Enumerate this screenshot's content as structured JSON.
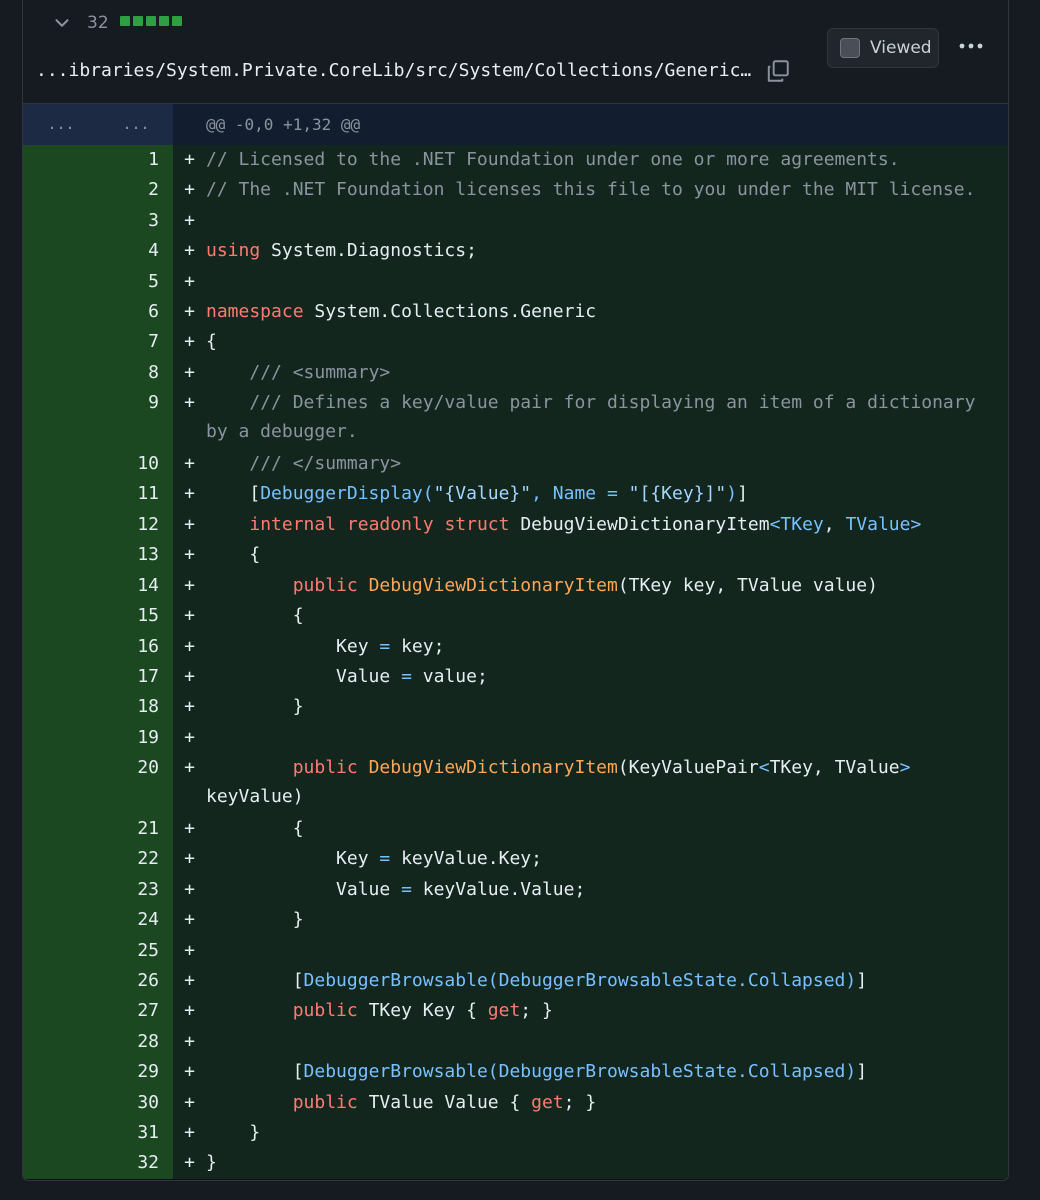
{
  "header": {
    "lines_count": "32",
    "path": "...ibraries/System.Private.CoreLib/src/System/Collections/Generic…",
    "viewed_label": "Viewed"
  },
  "hunk": {
    "old_gutter": "...",
    "new_gutter": "...",
    "header": "@@ -0,0 +1,32 @@"
  },
  "diff": {
    "marker": "+",
    "lines": [
      {
        "n": "1",
        "tokens": [
          [
            "c",
            "// Licensed to the .NET Foundation under one or more agreements."
          ]
        ]
      },
      {
        "n": "2",
        "tokens": [
          [
            "c",
            "// The .NET Foundation licenses this file to you under the MIT license."
          ]
        ]
      },
      {
        "n": "3",
        "tokens": []
      },
      {
        "n": "4",
        "tokens": [
          [
            "k",
            "using"
          ],
          [
            "p",
            " System.Diagnostics;"
          ]
        ]
      },
      {
        "n": "5",
        "tokens": []
      },
      {
        "n": "6",
        "tokens": [
          [
            "k",
            "namespace"
          ],
          [
            "p",
            " System.Collections.Generic"
          ]
        ]
      },
      {
        "n": "7",
        "tokens": [
          [
            "p",
            "{"
          ]
        ]
      },
      {
        "n": "8",
        "tokens": [
          [
            "p",
            "    "
          ],
          [
            "c",
            "/// <summary>"
          ]
        ]
      },
      {
        "n": "9",
        "tokens": [
          [
            "p",
            "    "
          ],
          [
            "c",
            "/// Defines a key/value pair for displaying an item of a dictionary"
          ]
        ],
        "cont": [
          [
            "c",
            "by a debugger."
          ]
        ]
      },
      {
        "n": "10",
        "tokens": [
          [
            "p",
            "    "
          ],
          [
            "c",
            "/// </summary>"
          ]
        ]
      },
      {
        "n": "11",
        "tokens": [
          [
            "p",
            "    ["
          ],
          [
            "a",
            "DebuggerDisplay("
          ],
          [
            "s",
            "\"{Value}\""
          ],
          [
            "a",
            ", Name = "
          ],
          [
            "s",
            "\"[{Key}]\""
          ],
          [
            "a",
            ")"
          ],
          [
            "p",
            "]"
          ]
        ]
      },
      {
        "n": "12",
        "tokens": [
          [
            "p",
            "    "
          ],
          [
            "k",
            "internal"
          ],
          [
            "p",
            " "
          ],
          [
            "k",
            "readonly"
          ],
          [
            "p",
            " "
          ],
          [
            "k",
            "struct"
          ],
          [
            "p",
            " DebugViewDictionaryItem"
          ],
          [
            "a",
            "<TKey"
          ],
          [
            "p",
            ", "
          ],
          [
            "a",
            "TValue>"
          ]
        ]
      },
      {
        "n": "13",
        "tokens": [
          [
            "p",
            "    {"
          ]
        ]
      },
      {
        "n": "14",
        "tokens": [
          [
            "p",
            "        "
          ],
          [
            "k",
            "public"
          ],
          [
            "p",
            " "
          ],
          [
            "f",
            "DebugViewDictionaryItem"
          ],
          [
            "p",
            "(TKey key, TValue value)"
          ]
        ]
      },
      {
        "n": "15",
        "tokens": [
          [
            "p",
            "        {"
          ]
        ]
      },
      {
        "n": "16",
        "tokens": [
          [
            "p",
            "            Key "
          ],
          [
            "a",
            "="
          ],
          [
            "p",
            " key;"
          ]
        ]
      },
      {
        "n": "17",
        "tokens": [
          [
            "p",
            "            Value "
          ],
          [
            "a",
            "="
          ],
          [
            "p",
            " value;"
          ]
        ]
      },
      {
        "n": "18",
        "tokens": [
          [
            "p",
            "        }"
          ]
        ]
      },
      {
        "n": "19",
        "tokens": []
      },
      {
        "n": "20",
        "tokens": [
          [
            "p",
            "        "
          ],
          [
            "k",
            "public"
          ],
          [
            "p",
            " "
          ],
          [
            "f",
            "DebugViewDictionaryItem"
          ],
          [
            "p",
            "(KeyValuePair"
          ],
          [
            "a",
            "<"
          ],
          [
            "p",
            "TKey, TValue"
          ],
          [
            "a",
            ">"
          ]
        ],
        "cont": [
          [
            "p",
            "keyValue)"
          ]
        ]
      },
      {
        "n": "21",
        "tokens": [
          [
            "p",
            "        {"
          ]
        ]
      },
      {
        "n": "22",
        "tokens": [
          [
            "p",
            "            Key "
          ],
          [
            "a",
            "="
          ],
          [
            "p",
            " keyValue.Key;"
          ]
        ]
      },
      {
        "n": "23",
        "tokens": [
          [
            "p",
            "            Value "
          ],
          [
            "a",
            "="
          ],
          [
            "p",
            " keyValue.Value;"
          ]
        ]
      },
      {
        "n": "24",
        "tokens": [
          [
            "p",
            "        }"
          ]
        ]
      },
      {
        "n": "25",
        "tokens": []
      },
      {
        "n": "26",
        "tokens": [
          [
            "p",
            "        ["
          ],
          [
            "a",
            "DebuggerBrowsable(DebuggerBrowsableState.Collapsed)"
          ],
          [
            "p",
            "]"
          ]
        ]
      },
      {
        "n": "27",
        "tokens": [
          [
            "p",
            "        "
          ],
          [
            "k",
            "public"
          ],
          [
            "p",
            " TKey Key { "
          ],
          [
            "k",
            "get"
          ],
          [
            "p",
            "; }"
          ]
        ]
      },
      {
        "n": "28",
        "tokens": []
      },
      {
        "n": "29",
        "tokens": [
          [
            "p",
            "        ["
          ],
          [
            "a",
            "DebuggerBrowsable(DebuggerBrowsableState.Collapsed)"
          ],
          [
            "p",
            "]"
          ]
        ]
      },
      {
        "n": "30",
        "tokens": [
          [
            "p",
            "        "
          ],
          [
            "k",
            "public"
          ],
          [
            "p",
            " TValue Value { "
          ],
          [
            "k",
            "get"
          ],
          [
            "p",
            "; }"
          ]
        ]
      },
      {
        "n": "31",
        "tokens": [
          [
            "p",
            "    }"
          ]
        ]
      },
      {
        "n": "32",
        "tokens": [
          [
            "p",
            "}"
          ]
        ]
      }
    ]
  }
}
